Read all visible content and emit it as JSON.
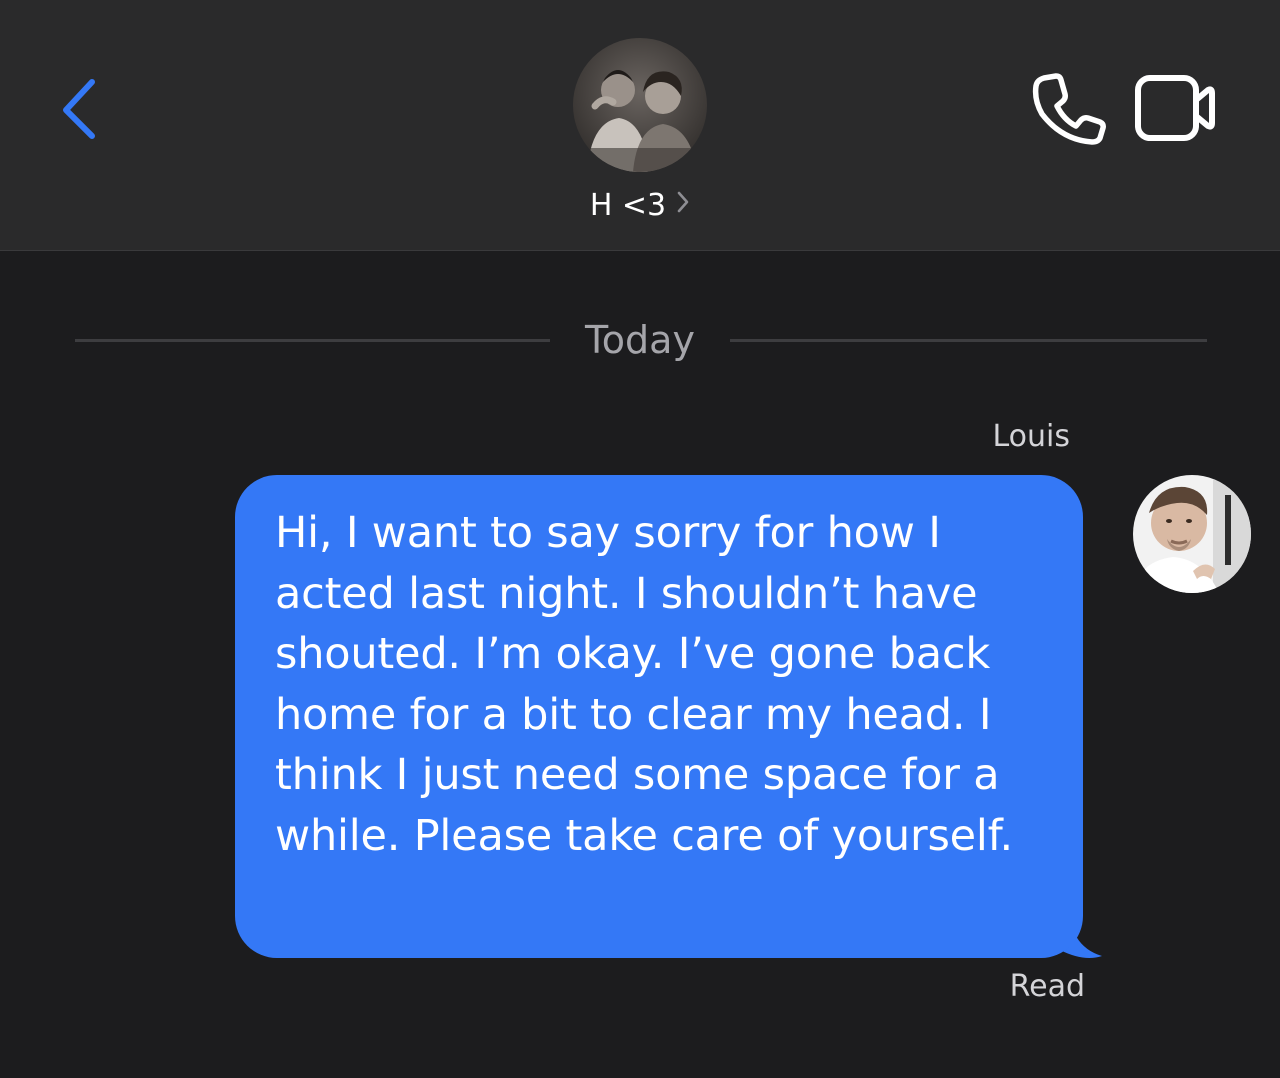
{
  "header": {
    "contact_name": "H <3",
    "contact_avatar": "contact-avatar-photo",
    "back_icon": "chevron-left-icon",
    "call_icon": "phone-icon",
    "video_icon": "video-camera-icon",
    "accent_color": "#3478f6"
  },
  "thread": {
    "date_label": "Today",
    "messages": [
      {
        "sender": "Louis",
        "text": "Hi, I want to say sorry for how I acted last night. I shouldn’t have shouted. I’m okay. I’ve gone back home for a bit to clear my head. I think I just need some space for a while. Please take care of yourself.",
        "status": "Read",
        "bubble_color": "#3478f6",
        "avatar": "sender-avatar-photo"
      }
    ]
  }
}
